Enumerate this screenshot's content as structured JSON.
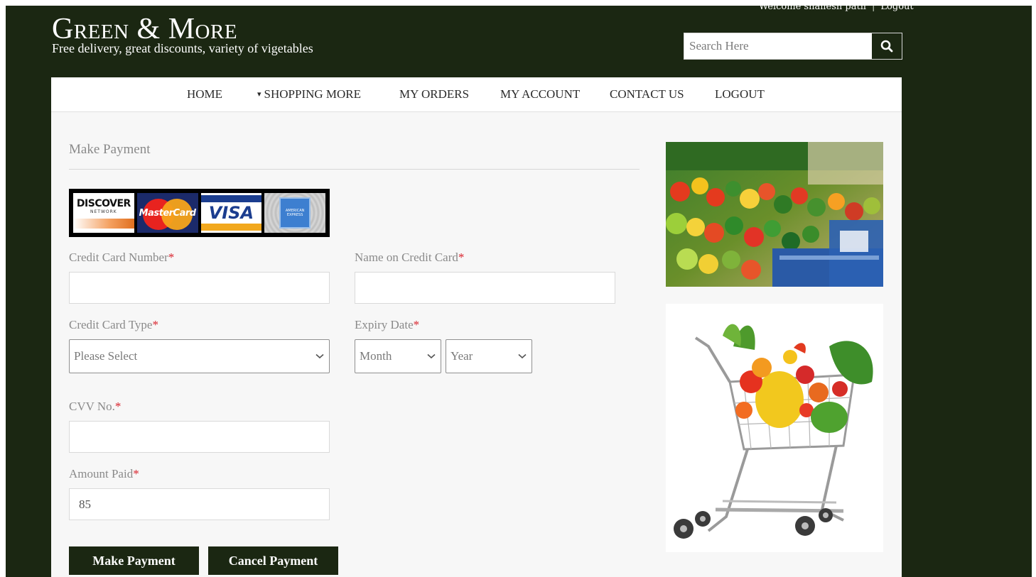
{
  "header": {
    "welcome_text": "Welcome shailesh patil",
    "separator": "|",
    "logout_link": "Logout",
    "logo_text": "Green & More",
    "tagline": "Free delivery, great discounts, variety of vigetables",
    "search_placeholder": "Search Here",
    "search_icon": "search-icon"
  },
  "nav": {
    "items": [
      "HOME",
      "SHOPPING MORE",
      "MY ORDERS",
      "MY ACCOUNT",
      "CONTACT US",
      "LOGOUT"
    ],
    "dropdown_marker": "▾"
  },
  "form": {
    "title": "Make Payment",
    "cards": {
      "discover": "DISCOVER",
      "discover_sub": "NETWORK",
      "mastercard": "MasterCard",
      "visa": "VISA",
      "amex": "AMERICAN EXPRESS"
    },
    "required_marker": "*",
    "card_number_label": "Credit Card Number",
    "card_number_value": "",
    "name_label": "Name on Credit Card",
    "name_value": "",
    "card_type_label": "Credit Card Type",
    "card_type_selected": "Please Select",
    "expiry_label": "Expiry Date",
    "expiry_month_selected": "Month",
    "expiry_year_selected": "Year",
    "cvv_label": "CVV No.",
    "cvv_value": "",
    "amount_label": "Amount Paid",
    "amount_value": "85",
    "make_payment_button": "Make Payment",
    "cancel_payment_button": "Cancel Payment"
  },
  "colors": {
    "header_bg": "#1b2712",
    "content_bg": "#f7f7f7",
    "required": "#d9232d",
    "button_bg": "#1b2712"
  }
}
